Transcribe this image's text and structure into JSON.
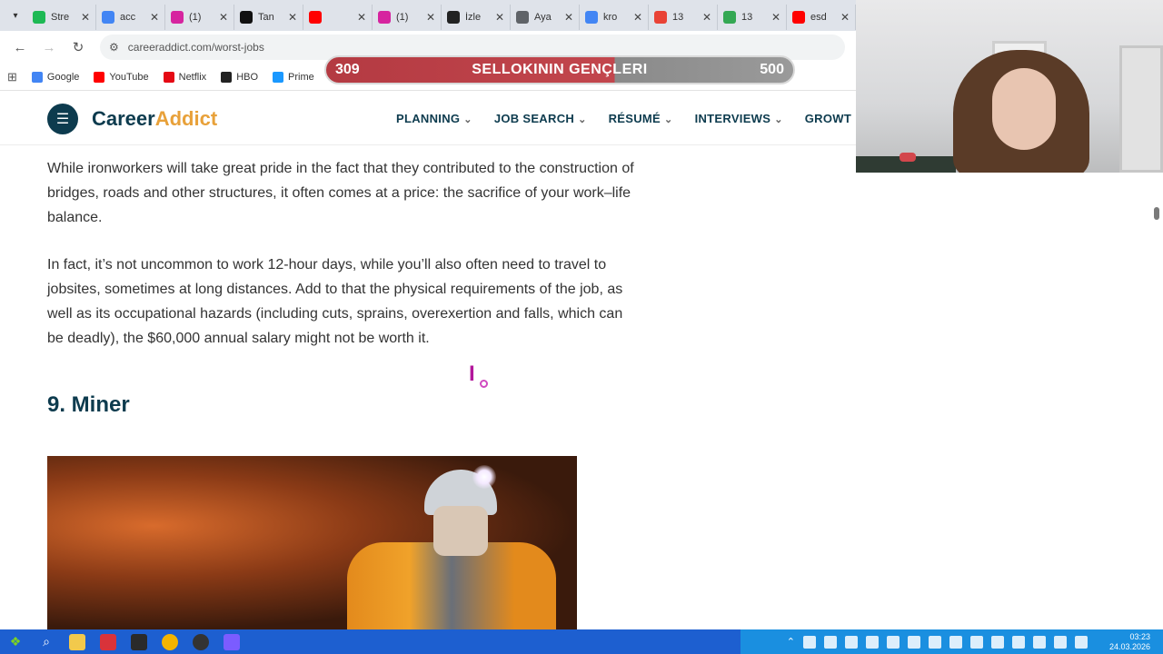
{
  "browser": {
    "tabs": [
      {
        "title": "Stre",
        "favicon_color": "#1db954",
        "icon": "k-icon"
      },
      {
        "title": "acc",
        "favicon_color": "#4285f4",
        "icon": "google-icon"
      },
      {
        "title": "(1)",
        "favicon_color": "#d6249f",
        "icon": "instagram-icon"
      },
      {
        "title": "Tan",
        "favicon_color": "#111111",
        "icon": "tiktok-icon"
      },
      {
        "title": "",
        "favicon_color": "#ff0000",
        "icon": "youtube-icon"
      },
      {
        "title": "(1)",
        "favicon_color": "#d6249f",
        "icon": "instagram-icon"
      },
      {
        "title": "İzle",
        "favicon_color": "#222222",
        "icon": "stream-icon"
      },
      {
        "title": "Aya",
        "favicon_color": "#5f6368",
        "icon": "gear-icon"
      },
      {
        "title": "kro",
        "favicon_color": "#4285f4",
        "icon": "google-icon"
      },
      {
        "title": "13",
        "favicon_color": "#e94235",
        "icon": "grid-icon"
      },
      {
        "title": "13",
        "favicon_color": "#34a853",
        "icon": "circle-icon"
      },
      {
        "title": "esd",
        "favicon_color": "#ff0000",
        "icon": "youtube-icon"
      }
    ],
    "url": "careeraddict.com/worst-jobs",
    "bookmarks": [
      {
        "label": "Google",
        "color": "#4285f4"
      },
      {
        "label": "YouTube",
        "color": "#ff0000"
      },
      {
        "label": "Netflix",
        "color": "#e50914"
      },
      {
        "label": "HBO",
        "color": "#222222"
      },
      {
        "label": "Prime",
        "color": "#1a98ff"
      }
    ]
  },
  "overlay": {
    "left_value": "309",
    "title": "SELLOKININ GENÇLERI",
    "right_value": "500",
    "progress_fraction": 0.618
  },
  "site": {
    "logo_main": "Career",
    "logo_accent": "Addict",
    "nav": [
      "PLANNING",
      "JOB SEARCH",
      "RÉSUMÉ",
      "INTERVIEWS",
      "GROWT"
    ],
    "paragraphs": [
      "While ironworkers will take great pride in the fact that they contributed to the construction of bridges, roads and other structures, it often comes at a price: the sacrifice of your work–life balance.",
      "In fact, it’s not uncommon to work 12-hour days, while you’ll also often need to travel to jobsites, sometimes at long distances. Add to that the physical requirements of the job, as well as its occupational hazards (including cuts, sprains, overexertion and falls, which can be deadly), the $60,000 annual salary might not be worth it."
    ],
    "heading": "9. Miner"
  },
  "taskbar": {
    "time": "03:23",
    "date": "24.03.2026",
    "colors": {
      "bar": "#1d5fd0",
      "tray": "#1a8fe0"
    }
  }
}
